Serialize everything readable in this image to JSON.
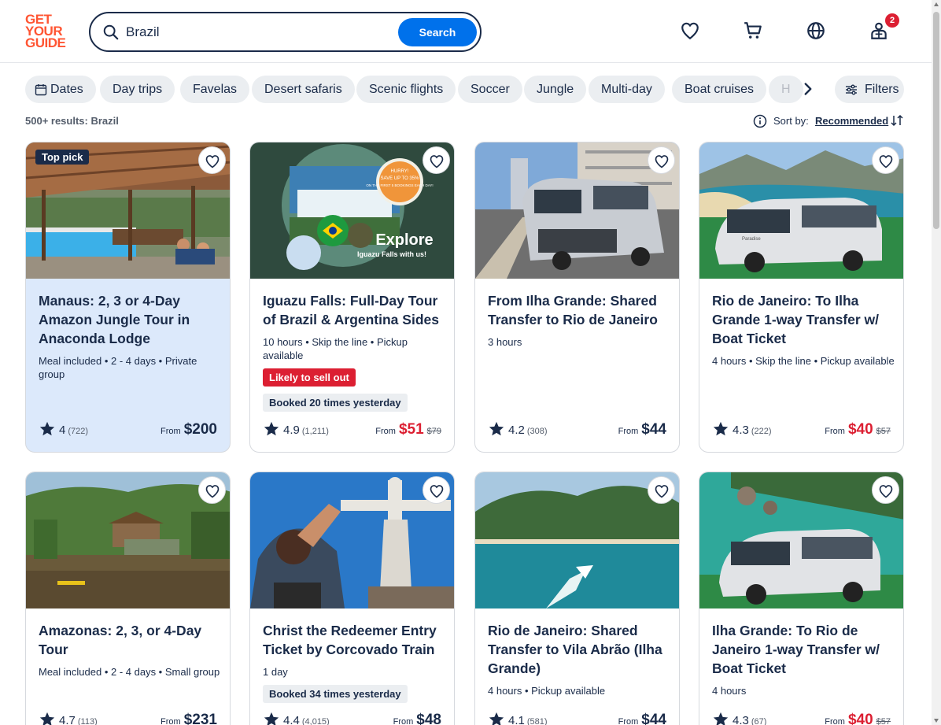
{
  "logo": {
    "line1": "GET",
    "line2": "YOUR",
    "line3": "GUIDE"
  },
  "search": {
    "value": "Brazil",
    "button": "Search"
  },
  "header": {
    "cart_count": "2"
  },
  "chips": [
    "Dates",
    "Day trips",
    "Favelas",
    "Desert safaris",
    "Scenic flights",
    "Soccer",
    "Jungle",
    "Multi-day",
    "Boat cruises",
    "H"
  ],
  "filters_label": "Filters",
  "results_label": "500+ results: Brazil",
  "sort": {
    "label": "Sort by:",
    "value": "Recommended"
  },
  "cards": [
    {
      "badge": "Top pick",
      "title": "Manaus: 2, 3 or 4-Day Amazon Jungle Tour in Anaconda Lodge",
      "meta": "Meal included • 2 - 4 days • Private group",
      "rating": "4",
      "reviews": "(722)",
      "from": "From",
      "price": "$200",
      "old_price": ""
    },
    {
      "title": "Iguazu Falls: Full-Day Tour of Brazil & Argentina Sides",
      "meta": "10 hours • Skip the line • Pickup available",
      "tag_sell": "Likely to sell out",
      "tag_booked": "Booked 20 times yesterday",
      "rating": "4.9",
      "reviews": "(1,211)",
      "from": "From",
      "price": "$51",
      "old_price": "$79"
    },
    {
      "title": "From Ilha Grande: Shared Transfer to Rio de Janeiro",
      "meta": "3 hours",
      "rating": "4.2",
      "reviews": "(308)",
      "from": "From",
      "price": "$44",
      "old_price": ""
    },
    {
      "title": "Rio de Janeiro: To Ilha Grande 1-way Transfer w/ Boat Ticket",
      "meta": "4 hours • Skip the line • Pickup available",
      "rating": "4.3",
      "reviews": "(222)",
      "from": "From",
      "price": "$40",
      "old_price": "$57"
    },
    {
      "title": "Amazonas: 2, 3, or 4-Day Tour",
      "meta": "Meal included • 2 - 4 days • Small group",
      "rating": "4.7",
      "reviews": "(113)",
      "from": "From",
      "price": "$231",
      "old_price": ""
    },
    {
      "title": "Christ the Redeemer Entry Ticket by Corcovado Train",
      "meta": "1 day",
      "tag_booked": "Booked 34 times yesterday",
      "rating": "4.4",
      "reviews": "(4,015)",
      "from": "From",
      "price": "$48",
      "old_price": ""
    },
    {
      "title": "Rio de Janeiro: Shared Transfer to Vila Abrão (Ilha Grande)",
      "meta": "4 hours • Pickup available",
      "rating": "4.1",
      "reviews": "(581)",
      "from": "From",
      "price": "$44",
      "old_price": ""
    },
    {
      "title": "Ilha Grande: To Rio de Janeiro 1-way Transfer w/ Boat Ticket",
      "meta": "4 hours",
      "rating": "4.3",
      "reviews": "(67)",
      "from": "From",
      "price": "$40",
      "old_price": "$57"
    }
  ],
  "image_texts": {
    "promo_line1": "HURRY!",
    "promo_line2": "SAVE UP TO 35%",
    "promo_line3": "ON THE FIRST 5 BOOKINGS EACH DAY!",
    "explore_1": "Explore",
    "explore_2": "Iguazu Falls with us!",
    "van_brand": "Paradise"
  },
  "colors": {
    "brand": "#ff5533",
    "primary": "#0071eb",
    "text": "#1a2b49",
    "sale": "#dc1f32",
    "chip_bg": "#ebeef1",
    "highlight": "#dce9fb"
  }
}
